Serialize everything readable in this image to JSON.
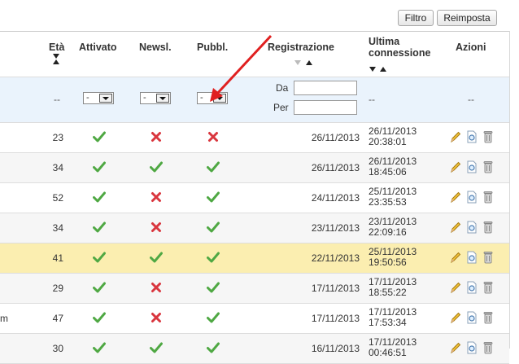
{
  "toolbar": {
    "filter_label": "Filtro",
    "reset_label": "Reimposta"
  },
  "headers": {
    "age": "Età",
    "activated": "Attivato",
    "newsletter": "Newsl.",
    "published": "Pubbl.",
    "registration": "Registrazione",
    "last_login_line1": "Ultima",
    "last_login_line2": "connessione",
    "actions": "Azioni"
  },
  "filters": {
    "age": "--",
    "activated": "-",
    "newsletter": "-",
    "published": "-",
    "from_label": "Da",
    "to_label": "Per",
    "last_login": "--",
    "actions": "--"
  },
  "rows": [
    {
      "age": "23",
      "activated": "check",
      "newsletter": "cross",
      "published": "cross",
      "registered": "26/11/2013",
      "last_date": "26/11/2013",
      "last_time": "20:38:01",
      "fragment": ""
    },
    {
      "age": "34",
      "activated": "check",
      "newsletter": "check",
      "published": "check",
      "registered": "26/11/2013",
      "last_date": "26/11/2013",
      "last_time": "18:45:06",
      "fragment": ""
    },
    {
      "age": "52",
      "activated": "check",
      "newsletter": "cross",
      "published": "check",
      "registered": "24/11/2013",
      "last_date": "25/11/2013",
      "last_time": "23:35:53",
      "fragment": ""
    },
    {
      "age": "34",
      "activated": "check",
      "newsletter": "cross",
      "published": "check",
      "registered": "23/11/2013",
      "last_date": "23/11/2013",
      "last_time": "22:09:16",
      "fragment": ""
    },
    {
      "age": "41",
      "activated": "check",
      "newsletter": "check",
      "published": "check",
      "registered": "22/11/2013",
      "last_date": "25/11/2013",
      "last_time": "19:50:56",
      "fragment": ""
    },
    {
      "age": "29",
      "activated": "check",
      "newsletter": "cross",
      "published": "check",
      "registered": "17/11/2013",
      "last_date": "17/11/2013",
      "last_time": "18:55:22",
      "fragment": ""
    },
    {
      "age": "47",
      "activated": "check",
      "newsletter": "cross",
      "published": "check",
      "registered": "17/11/2013",
      "last_date": "17/11/2013",
      "last_time": "17:53:34",
      "fragment": "m"
    },
    {
      "age": "30",
      "activated": "check",
      "newsletter": "check",
      "published": "check",
      "registered": "16/11/2013",
      "last_date": "17/11/2013",
      "last_time": "00:46:51",
      "fragment": ""
    }
  ],
  "icons": {
    "edit": "pencil-icon",
    "view": "magnifier-page-icon",
    "delete": "trash-icon",
    "check": "green-check-icon",
    "cross": "red-cross-icon"
  },
  "colors": {
    "check": "#4fa843",
    "cross": "#d9363e",
    "highlight_row": "#fbeeb0",
    "filter_row": "#eaf3fc",
    "annotation_arrow": "#e02020"
  }
}
